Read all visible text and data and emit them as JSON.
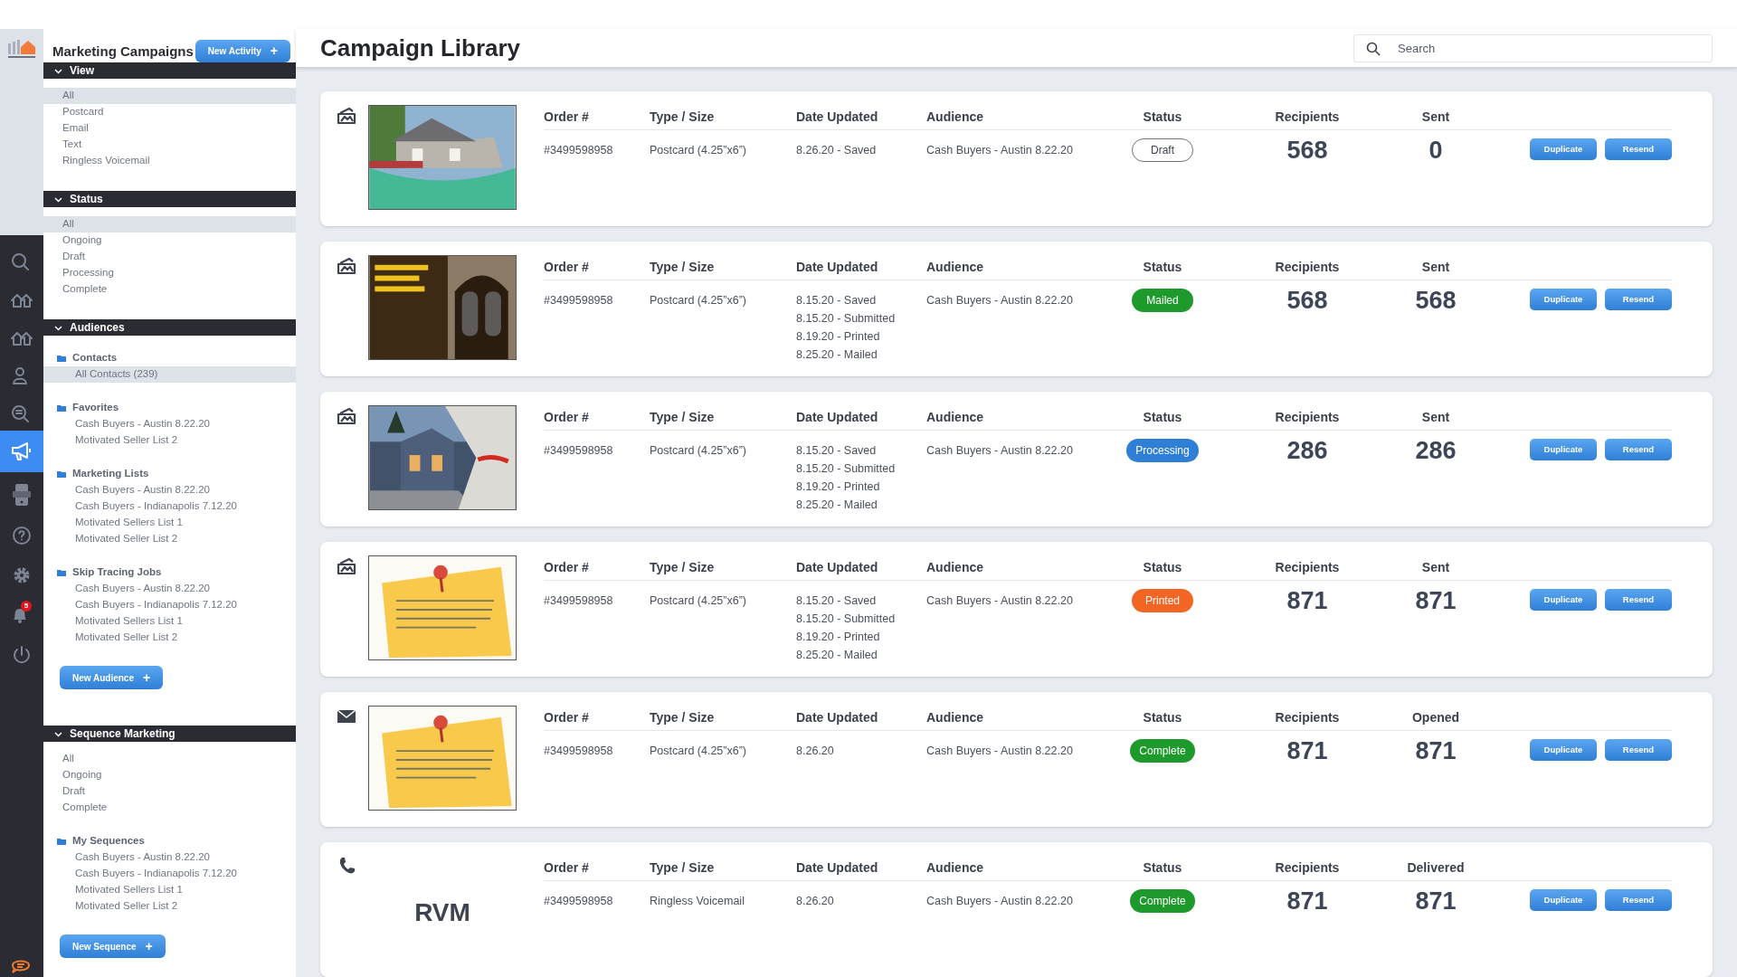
{
  "sidebar": {
    "title": "Marketing Campaigns",
    "new_button": "New Activity",
    "plus": "+",
    "sections": [
      {
        "title": "View",
        "expanded": true,
        "items": [
          {
            "label": "All",
            "selected": true
          },
          {
            "label": "Postcard",
            "selected": false
          },
          {
            "label": "Email",
            "selected": false
          },
          {
            "label": "Text",
            "selected": false
          },
          {
            "label": "Ringless Voicemail",
            "selected": false
          }
        ]
      },
      {
        "title": "Status",
        "expanded": true,
        "items": [
          {
            "label": "All",
            "selected": true
          },
          {
            "label": "Ongoing",
            "selected": false
          },
          {
            "label": "Draft",
            "selected": false
          },
          {
            "label": "Processing",
            "selected": false
          },
          {
            "label": "Complete",
            "selected": false
          }
        ]
      },
      {
        "title": "Audiences",
        "expanded": true,
        "groups": [
          {
            "title": "Contacts",
            "items": [
              {
                "label": "All Contacts (239)",
                "selected": true
              }
            ]
          },
          {
            "title": "Favorites",
            "items": [
              {
                "label": "Cash Buyers - Austin 8.22.20",
                "selected": false
              },
              {
                "label": "Motivated Seller List 2",
                "selected": false
              }
            ]
          },
          {
            "title": "Marketing Lists",
            "items": [
              {
                "label": "Cash Buyers - Austin 8.22.20",
                "selected": false
              },
              {
                "label": "Cash Buyers - Indianapolis 7.12.20",
                "selected": false
              },
              {
                "label": "Motivated Sellers List 1",
                "selected": false
              },
              {
                "label": "Motivated Seller List 2",
                "selected": false
              }
            ]
          },
          {
            "title": "Skip Tracing Jobs",
            "items": [
              {
                "label": "Cash Buyers - Austin 8.22.20",
                "selected": false
              },
              {
                "label": "Cash Buyers - Indianapolis 7.12.20",
                "selected": false
              },
              {
                "label": "Motivated Sellers List 1",
                "selected": false
              },
              {
                "label": "Motivated Seller List 2",
                "selected": false
              }
            ]
          }
        ],
        "button": "New Audience",
        "button_plus": "+"
      },
      {
        "title": "Sequence Marketing",
        "expanded": true,
        "items": [
          {
            "label": "All",
            "selected": false
          },
          {
            "label": "Ongoing",
            "selected": false
          },
          {
            "label": "Draft",
            "selected": false
          },
          {
            "label": "Complete",
            "selected": false
          }
        ],
        "groups": [
          {
            "title": "My Sequences",
            "items": [
              {
                "label": "Cash Buyers - Austin 8.22.20",
                "selected": false
              },
              {
                "label": "Cash Buyers - Indianapolis 7.12.20",
                "selected": false
              },
              {
                "label": "Motivated Sellers List 1",
                "selected": false
              },
              {
                "label": "Motivated Seller List 2",
                "selected": false
              }
            ]
          }
        ],
        "button": "New Sequence",
        "button_plus": "+"
      }
    ]
  },
  "rail": {
    "notification_count": "5"
  },
  "header": {
    "title": "Campaign Library",
    "search": {
      "placeholder": "Search"
    }
  },
  "campaigns": [
    {
      "kind": "postcard",
      "preview": {
        "kind": "picture"
      },
      "headers": [
        "Order #",
        "Type / Size",
        "Date Updated",
        "Audience",
        "Status",
        "Recipients",
        "Sent"
      ],
      "order": "#3499598958",
      "type": "Postcard (4.25”x6”)",
      "dates": [
        "8.26.20 - Saved"
      ],
      "audience": "Cash Buyers - Austin 8.22.20",
      "status": {
        "label": "Draft",
        "kind": "draft",
        "color": "#6b7280"
      },
      "recipients": "568",
      "count": "0",
      "buttons": [
        "Duplicate",
        "Resend"
      ]
    },
    {
      "kind": "postcard",
      "preview": {
        "kind": "picture"
      },
      "headers": [
        "Order #",
        "Type / Size",
        "Date Updated",
        "Audience",
        "Status",
        "Recipients",
        "Sent"
      ],
      "order": "#3499598958",
      "type": "Postcard (4.25”x6”)",
      "dates": [
        "8.15.20 - Saved",
        "8.15.20 - Submitted",
        "8.19.20 - Printed",
        "8.25.20 - Mailed"
      ],
      "audience": "Cash Buyers - Austin 8.22.20",
      "status": {
        "label": "Mailed",
        "kind": "mailed",
        "color": "#1e9a2c"
      },
      "recipients": "568",
      "count": "568",
      "buttons": [
        "Duplicate",
        "Resend"
      ]
    },
    {
      "kind": "postcard",
      "preview": {
        "kind": "picture"
      },
      "headers": [
        "Order #",
        "Type / Size",
        "Date Updated",
        "Audience",
        "Status",
        "Recipients",
        "Sent"
      ],
      "order": "#3499598958",
      "type": "Postcard (4.25”x6”)",
      "dates": [
        "8.15.20 - Saved",
        "8.15.20 - Submitted",
        "8.19.20 - Printed",
        "8.25.20 - Mailed"
      ],
      "audience": "Cash Buyers - Austin 8.22.20",
      "status": {
        "label": "Processing",
        "kind": "processing",
        "color": "#2f7fd6"
      },
      "recipients": "286",
      "count": "286",
      "buttons": [
        "Duplicate",
        "Resend"
      ]
    },
    {
      "kind": "postcard",
      "preview": {
        "kind": "picture"
      },
      "headers": [
        "Order #",
        "Type / Size",
        "Date Updated",
        "Audience",
        "Status",
        "Recipients",
        "Sent"
      ],
      "order": "#3499598958",
      "type": "Postcard (4.25”x6”)",
      "dates": [
        "8.15.20 - Saved",
        "8.15.20 - Submitted",
        "8.19.20 - Printed",
        "8.25.20 - Mailed"
      ],
      "audience": "Cash Buyers - Austin 8.22.20",
      "status": {
        "label": "Printed",
        "kind": "printed",
        "color": "#f26522"
      },
      "recipients": "871",
      "count": "871",
      "buttons": [
        "Duplicate",
        "Resend"
      ]
    },
    {
      "kind": "email",
      "preview": {
        "kind": "picture"
      },
      "headers": [
        "Order #",
        "Type / Size",
        "Date Updated",
        "Audience",
        "Status",
        "Recipients",
        "Opened"
      ],
      "order": "#3499598958",
      "type": "Postcard (4.25”x6”)",
      "dates": [
        "8.26.20"
      ],
      "audience": "Cash Buyers - Austin 8.22.20",
      "status": {
        "label": "Complete",
        "kind": "complete",
        "color": "#1e9a2c"
      },
      "recipients": "871",
      "count": "871",
      "buttons": [
        "Duplicate",
        "Resend"
      ]
    },
    {
      "kind": "phone",
      "preview": {
        "kind": "text",
        "text": "RVM"
      },
      "headers": [
        "Order #",
        "Type / Size",
        "Date Updated",
        "Audience",
        "Status",
        "Recipients",
        "Delivered"
      ],
      "order": "#3499598958",
      "type": "Ringless Voicemail",
      "dates": [
        "8.26.20"
      ],
      "audience": "Cash Buyers - Austin 8.22.20",
      "status": {
        "label": "Complete",
        "kind": "complete",
        "color": "#1e9a2c"
      },
      "recipients": "871",
      "count": "871",
      "buttons": [
        "Duplicate",
        "Resend"
      ]
    }
  ]
}
